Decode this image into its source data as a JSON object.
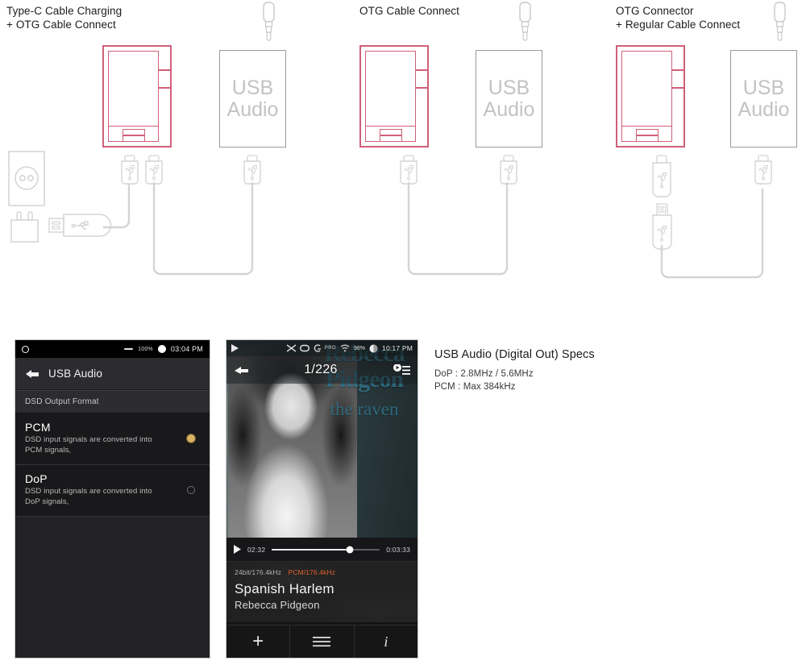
{
  "diagrams": [
    {
      "id": "type-c-charging-otg",
      "title": "Type-C Cable Charging\n+ OTG Cable Connect",
      "device_label": "USB\nAudio"
    },
    {
      "id": "otg-cable-connect",
      "title": "OTG Cable Connect",
      "device_label": "USB\nAudio"
    },
    {
      "id": "otg-connector-regular-cable",
      "title": "OTG Connector\n+ Regular Cable Connect",
      "device_label": "USB\nAudio"
    }
  ],
  "settings_screen": {
    "statusbar": {
      "battery_percent": "100%",
      "clock": "03:04 PM"
    },
    "header_title": "USB Audio",
    "section_label": "DSD Output Format",
    "options": [
      {
        "title": "PCM",
        "description": "DSD input signals are converted into PCM signals,",
        "selected": true
      },
      {
        "title": "DoP",
        "description": "DSD input signals are converted into DoP signals,",
        "selected": false
      }
    ]
  },
  "player_screen": {
    "statusbar": {
      "pro_label": "PRO",
      "battery_percent": "98%",
      "clock": "10:17 PM"
    },
    "track_count": "1/226",
    "album_art": {
      "line1": "Rebecca",
      "line2": "Pidgeon",
      "line3": "the raven"
    },
    "progress": {
      "elapsed": "02:32",
      "total": "0:03:33",
      "percent": 72
    },
    "format_bitdepth": "24bit/176.4kHz",
    "format_output": "PCM/176.4kHz",
    "track_title": "Spanish Harlem",
    "artist": "Rebecca Pidgeon",
    "nav": [
      "add-to-playlist",
      "queue-list",
      "track-info"
    ]
  },
  "specs": {
    "title": "USB Audio (Digital Out) Specs",
    "lines": [
      "DoP : 2.8MHz / 5.6MHz",
      "PCM : Max 384kHz"
    ]
  },
  "colors": {
    "player_outline": "#d06079",
    "device_outline": "#9a9a9a",
    "cable_stroke": "#d4d4d4",
    "accent_orange": "#e0602c",
    "radio_selected": "#d8b361",
    "album_text": "#2f6f85"
  }
}
